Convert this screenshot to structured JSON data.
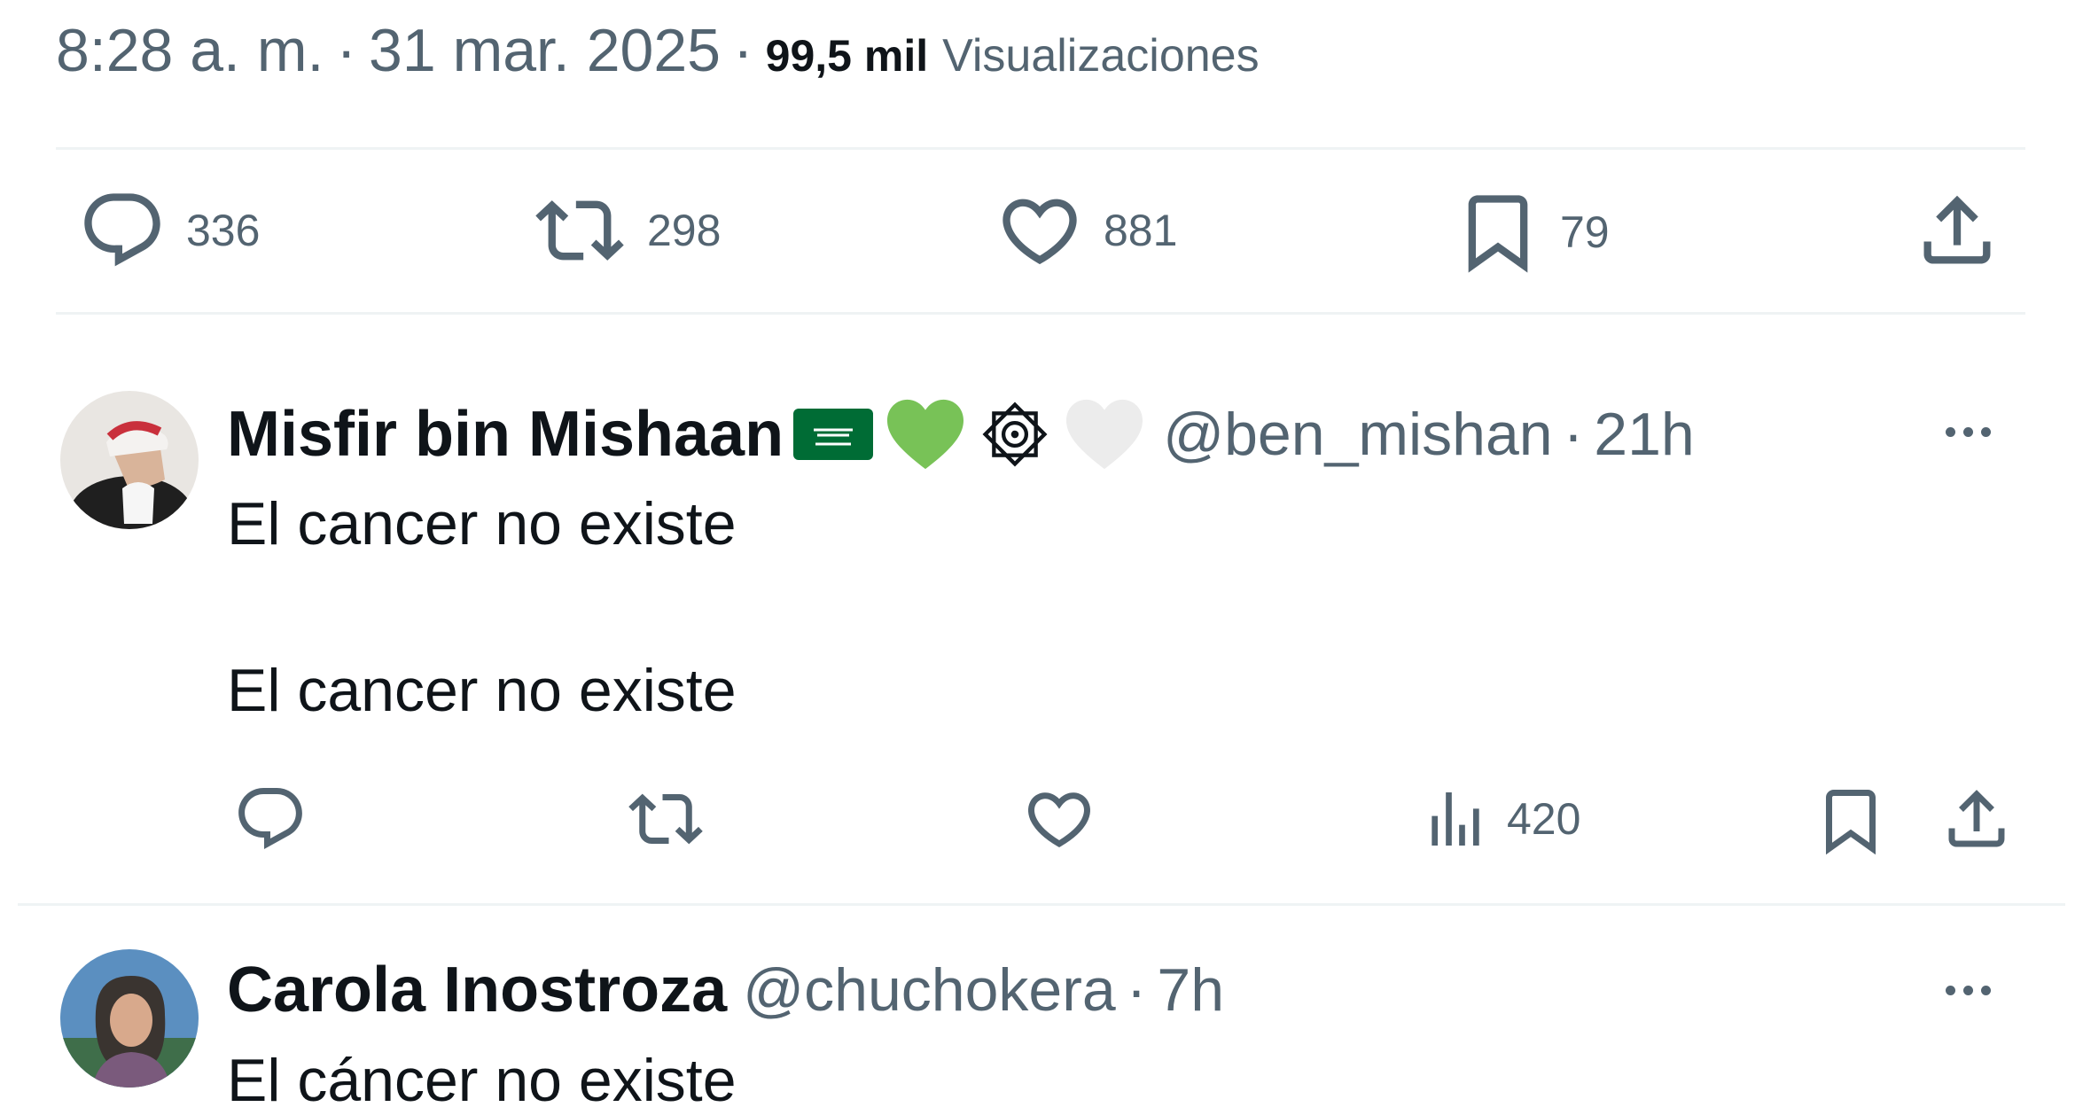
{
  "tweet": {
    "time": "8:28 a. m.",
    "separator": "·",
    "date": "31 mar. 2025",
    "views_count": "99,5 mil",
    "views_label": "Visualizaciones",
    "stats": {
      "replies": "336",
      "reposts": "298",
      "likes": "881",
      "bookmarks": "79"
    }
  },
  "replies": [
    {
      "name": "Misfir bin Mishaan",
      "handle": "@ben_mishan",
      "separator": "·",
      "time": "21h",
      "name_badges": [
        "saudi-flag-emoji",
        "green-heart-emoji",
        "ornament-emoji",
        "white-heart-emoji"
      ],
      "lines": [
        "El cancer no existe",
        "El cancer no existe"
      ],
      "views": "420"
    },
    {
      "name": "Carola Inostroza",
      "handle": "@chuchokera",
      "separator": "·",
      "time": "7h",
      "lines": [
        "El cáncer no existe"
      ]
    }
  ],
  "colors": {
    "text": "#0f1419",
    "muted": "#536471",
    "divider": "#eff3f4",
    "saudi_green": "#006c35",
    "heart_green": "#78c257"
  }
}
